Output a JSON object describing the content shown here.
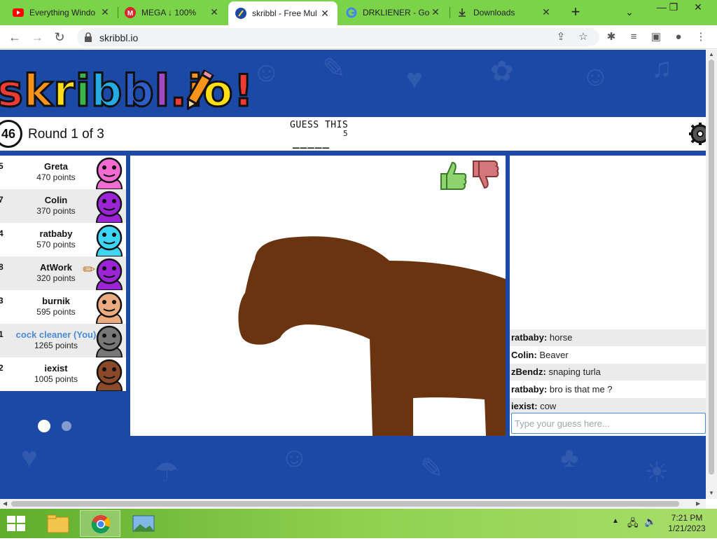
{
  "browser": {
    "tabs": [
      {
        "label": "Everything Windo",
        "icon": "youtube-icon"
      },
      {
        "label": "MEGA ↓ 100%",
        "icon": "mega-icon"
      },
      {
        "label": "skribbl - Free Mul",
        "icon": "skribbl-icon"
      },
      {
        "label": "DRKLIENER - Goo",
        "icon": "google-icon"
      },
      {
        "label": "Downloads",
        "icon": "download-icon"
      }
    ],
    "new_tab": "+",
    "url": "skribbl.io"
  },
  "game": {
    "logo": [
      "s",
      "k",
      "r",
      "i",
      "b",
      "b",
      "l",
      ".",
      "i",
      "o",
      "!"
    ],
    "logo_colors": [
      "#ef3b36",
      "#f7941d",
      "#ffde17",
      "#39b54a",
      "#27aae1",
      "#2e5cc8",
      "#a349c3",
      "#ef3b36",
      "#f7941d",
      "#ffde17",
      "#ef3b36"
    ],
    "timer": "46",
    "round_text": "Round 1 of 3",
    "guess_label": "GUESS THIS",
    "word_length": "5",
    "word_blanks": "_____",
    "players": [
      {
        "rank": "5",
        "name": "Greta",
        "points": "470 points",
        "avatar_color": "#f26bd0",
        "you": false
      },
      {
        "rank": "7",
        "name": "Colin",
        "points": "370 points",
        "avatar_color": "#9b25d6",
        "you": false
      },
      {
        "rank": "4",
        "name": "ratbaby",
        "points": "570 points",
        "avatar_color": "#3fd6f5",
        "you": false
      },
      {
        "rank": "8",
        "name": "AtWork",
        "points": "320 points",
        "avatar_color": "#9b25d6",
        "you": false
      },
      {
        "rank": "3",
        "name": "burnik",
        "points": "595 points",
        "avatar_color": "#e9ab7f",
        "you": false
      },
      {
        "rank": "1",
        "name": "cock cleaner (You)",
        "points": "1265 points",
        "avatar_color": "#777777",
        "you": true
      },
      {
        "rank": "2",
        "name": "iexist",
        "points": "1005 points",
        "avatar_color": "#8a4a2a",
        "you": false
      }
    ],
    "chat": [
      {
        "user": "ratbaby:",
        "text": "horse"
      },
      {
        "user": "Colin:",
        "text": "Beaver"
      },
      {
        "user": "zBendz:",
        "text": "snaping turla"
      },
      {
        "user": "ratbaby:",
        "text": "bro is that me ?"
      },
      {
        "user": "iexist:",
        "text": "cow"
      }
    ],
    "guess_placeholder": "Type your guess here...",
    "drawing_color": "#6b3410"
  },
  "taskbar": {
    "time": "7:21 PM",
    "date": "1/21/2023"
  }
}
